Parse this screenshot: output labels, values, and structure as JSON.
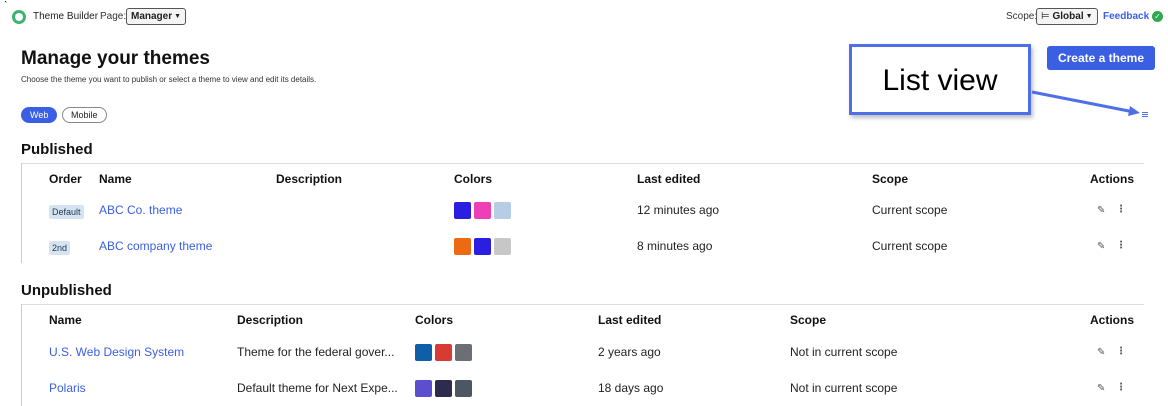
{
  "topbar": {
    "app_title": "Theme Builder",
    "page_label": "Page:",
    "page_value": "Manager",
    "scope_label": "Scope:",
    "scope_icon": "hierarchy-icon",
    "scope_value": "Global",
    "feedback": "Feedback"
  },
  "header": {
    "title": "Manage your themes",
    "subtitle": "Choose the theme you want to publish or select a theme to view and edit its details.",
    "create_button": "Create a theme"
  },
  "callout": {
    "text": "List view"
  },
  "platform_tabs": [
    "Web",
    "Mobile"
  ],
  "published": {
    "title": "Published",
    "columns": [
      "Order",
      "Name",
      "Description",
      "Colors",
      "Last edited",
      "Scope",
      "Actions"
    ],
    "rows": [
      {
        "order": "Default",
        "name": "ABC Co. theme",
        "description": "",
        "colors": [
          "#2a1fe0",
          "#ee3fb6",
          "#b7cde6"
        ],
        "last_edited": "12 minutes ago",
        "scope": "Current scope"
      },
      {
        "order": "2nd",
        "name": "ABC company theme",
        "description": "",
        "colors": [
          "#ec6a12",
          "#2a1fe0",
          "#c7c7c7"
        ],
        "last_edited": "8 minutes ago",
        "scope": "Current scope"
      }
    ]
  },
  "unpublished": {
    "title": "Unpublished",
    "columns": [
      "Name",
      "Description",
      "Colors",
      "Last edited",
      "Scope",
      "Actions"
    ],
    "rows": [
      {
        "name": "U.S. Web Design System",
        "description": "Theme for the federal gover...",
        "colors": [
          "#0e5ea8",
          "#d83a34",
          "#6b6e73"
        ],
        "last_edited": "2 years ago",
        "scope": "Not in current scope"
      },
      {
        "name": "Polaris",
        "description": "Default theme for Next Expe...",
        "colors": [
          "#5b4fcf",
          "#2d2c4e",
          "#4e5761"
        ],
        "last_edited": "18 days ago",
        "scope": "Not in current scope"
      }
    ]
  },
  "colors": {
    "accent": "#3b5fe3",
    "callout_border": "#4f6fe8"
  }
}
